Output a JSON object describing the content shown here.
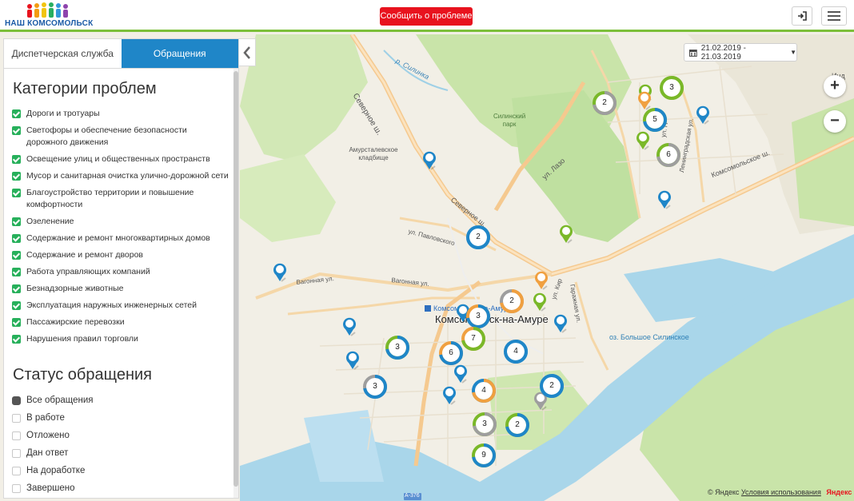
{
  "header": {
    "logo_text": "НАШ КОМСОМОЛЬСК",
    "report_button": "Сообщить о проблеме",
    "login_icon": "sign-in-icon",
    "menu_icon": "hamburger-menu-icon"
  },
  "sidebar": {
    "tabs": [
      {
        "label": "Диспетчерская служба",
        "active": false
      },
      {
        "label": "Обращения",
        "active": true
      }
    ],
    "categories_title": "Категории проблем",
    "categories": [
      {
        "label": "Дороги и тротуары",
        "checked": true
      },
      {
        "label": "Светофоры и обеспечение безопасности дорожного движения",
        "checked": true
      },
      {
        "label": "Освещение улиц и общественных пространств",
        "checked": true
      },
      {
        "label": "Мусор и санитарная очистка улично-дорожной сети",
        "checked": true
      },
      {
        "label": "Благоустройство территории и повышение комфортности",
        "checked": true
      },
      {
        "label": "Озеленение",
        "checked": true
      },
      {
        "label": "Содержание и ремонт многоквартирных домов",
        "checked": true
      },
      {
        "label": "Содержание и ремонт дворов",
        "checked": true
      },
      {
        "label": "Работа управляющих компаний",
        "checked": true
      },
      {
        "label": "Безнадзорные животные",
        "checked": true
      },
      {
        "label": "Эксплуатация наружных инженерных сетей",
        "checked": true
      },
      {
        "label": "Пассажирские перевозки",
        "checked": true
      },
      {
        "label": "Нарушения правил торговли",
        "checked": true
      }
    ],
    "status_title": "Статус обращения",
    "statuses": [
      {
        "label": "Все обращения",
        "selected": true
      },
      {
        "label": "В работе",
        "selected": false
      },
      {
        "label": "Отложено",
        "selected": false
      },
      {
        "label": "Дан ответ",
        "selected": false
      },
      {
        "label": "На доработке",
        "selected": false
      },
      {
        "label": "Завершено",
        "selected": false
      }
    ]
  },
  "map": {
    "date_range": "21.02.2019 - 21.03.2019",
    "zoom_in": "+",
    "zoom_out": "−",
    "city_label": "Комсомольск-на-Амуре",
    "station_label": "Комсомольск-на-Амуре",
    "labels": {
      "severnoe_sh": "Северное ш.",
      "silinka": "р. Силинка",
      "silinsky_park": "Силинский парк",
      "ul_lazo": "ул. Лазо",
      "amurstal_cemetery": "Амурсталевское кладбище",
      "severnoe_sh_2": "Северное ш.",
      "ul_pavlovskogo": "ул. Павловского",
      "vagonnaya_1": "Вагонная ул.",
      "vagonnaya_2": "Вагонная ул.",
      "ul_kirova": "ул. Кир",
      "garazhnaya": "Гаражная ул.",
      "lake": "оз. Большое Силинское",
      "leningradskaya": "Ленинградская ул.",
      "komsomolskoe_sh": "Комсомольское ш.",
      "ul_p": "ул. П",
      "ind": "Инд",
      "road_a376": "A-376"
    },
    "clusters": [
      {
        "count": "3",
        "color": "#7ab829",
        "secondary": "#7ab829"
      },
      {
        "count": "2",
        "color": "#9e9e9e",
        "secondary": "#7ab829"
      },
      {
        "count": "5",
        "color": "#1f86c8",
        "secondary": "#7ab829"
      },
      {
        "count": "6",
        "color": "#9e9e9e",
        "secondary": "#7ab829"
      },
      {
        "count": "2",
        "color": "#1f86c8",
        "secondary": "#1f86c8"
      },
      {
        "count": "2",
        "color": "#f0a040",
        "secondary": "#9e9e9e"
      },
      {
        "count": "3",
        "color": "#1f86c8",
        "secondary": "#f0a040"
      },
      {
        "count": "7",
        "color": "#7ab829",
        "secondary": "#f0a040"
      },
      {
        "count": "3",
        "color": "#1f86c8",
        "secondary": "#7ab829"
      },
      {
        "count": "6",
        "color": "#1f86c8",
        "secondary": "#f0a040"
      },
      {
        "count": "4",
        "color": "#1f86c8",
        "secondary": "#1f86c8"
      },
      {
        "count": "3",
        "color": "#1f86c8",
        "secondary": "#9e9e9e"
      },
      {
        "count": "4",
        "color": "#f0a040",
        "secondary": "#1f86c8"
      },
      {
        "count": "2",
        "color": "#1f86c8",
        "secondary": "#1f86c8"
      },
      {
        "count": "3",
        "color": "#9e9e9e",
        "secondary": "#7ab829"
      },
      {
        "count": "2",
        "color": "#1f86c8",
        "secondary": "#7ab829"
      },
      {
        "count": "9",
        "color": "#1f86c8",
        "secondary": "#7ab829"
      }
    ],
    "credits": {
      "copyright": "© Яндекс",
      "terms": "Условия использования",
      "brand": "Яндекс"
    }
  },
  "colors": {
    "accent_blue": "#1f86c8",
    "accent_green": "#7ab829",
    "accent_orange": "#f0a040",
    "neutral_gray": "#9e9e9e",
    "report_red": "#e8131e",
    "header_border": "#7cbf3a",
    "checkbox_green": "#27b05b",
    "water": "#a9d6ea",
    "map_land": "#f2efe6",
    "park_green": "#c6e3a6"
  }
}
